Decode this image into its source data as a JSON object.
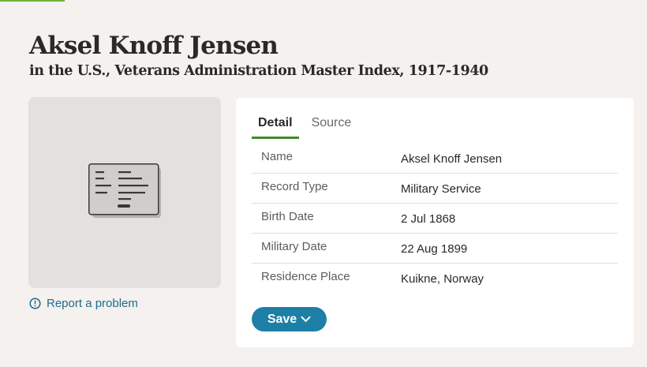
{
  "header": {
    "title": "Aksel Knoff Jensen",
    "subtitle": "in the U.S., Veterans Administration Master Index, 1917-1940"
  },
  "image_panel": {
    "icon": "record-card-icon",
    "report_link": "Report a problem"
  },
  "detail": {
    "tabs": [
      {
        "label": "Detail",
        "active": true
      },
      {
        "label": "Source",
        "active": false
      }
    ],
    "rows": [
      {
        "label": "Name",
        "value": "Aksel Knoff Jensen"
      },
      {
        "label": "Record Type",
        "value": "Military Service"
      },
      {
        "label": "Birth Date",
        "value": "2 Jul 1868"
      },
      {
        "label": "Military Date",
        "value": "22 Aug 1899"
      },
      {
        "label": "Residence Place",
        "value": "Kuikne, Norway"
      }
    ],
    "save_label": "Save"
  },
  "colors": {
    "accent_green": "#3f8a2e",
    "link_blue": "#1f6a8f",
    "button_blue": "#1d7fa6",
    "page_bg": "#f4f1ee"
  }
}
